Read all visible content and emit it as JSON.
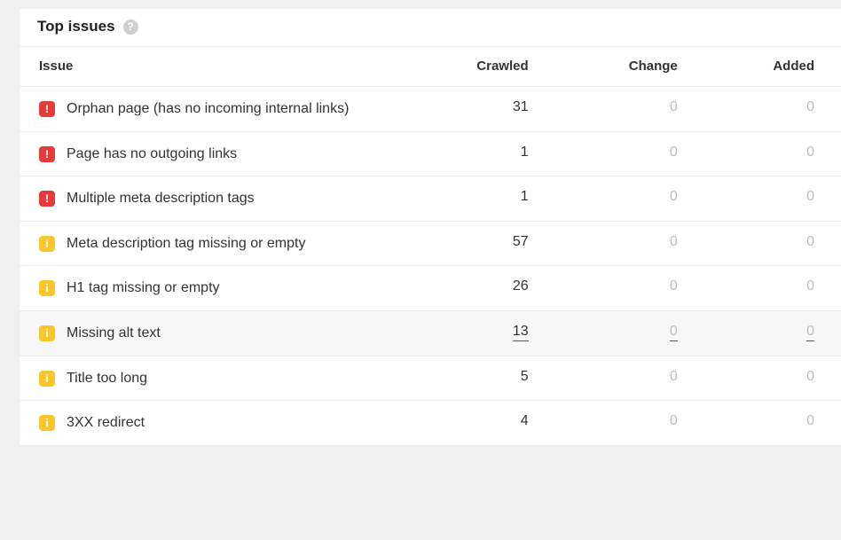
{
  "panel": {
    "title": "Top issues"
  },
  "columns": {
    "issue": "Issue",
    "crawled": "Crawled",
    "change": "Change",
    "added": "Added"
  },
  "severity_glyph": {
    "error": "!",
    "warning": "i"
  },
  "rows": [
    {
      "severity": "error",
      "issue": "Orphan page (has no incoming internal links)",
      "crawled": "31",
      "change": "0",
      "added": "0",
      "hover": false
    },
    {
      "severity": "error",
      "issue": "Page has no outgoing links",
      "crawled": "1",
      "change": "0",
      "added": "0",
      "hover": false
    },
    {
      "severity": "error",
      "issue": "Multiple meta description tags",
      "crawled": "1",
      "change": "0",
      "added": "0",
      "hover": false
    },
    {
      "severity": "warning",
      "issue": "Meta description tag missing or empty",
      "crawled": "57",
      "change": "0",
      "added": "0",
      "hover": false
    },
    {
      "severity": "warning",
      "issue": "H1 tag missing or empty",
      "crawled": "26",
      "change": "0",
      "added": "0",
      "hover": false
    },
    {
      "severity": "warning",
      "issue": "Missing alt text",
      "crawled": "13",
      "change": "0",
      "added": "0",
      "hover": true
    },
    {
      "severity": "warning",
      "issue": "Title too long",
      "crawled": "5",
      "change": "0",
      "added": "0",
      "hover": false
    },
    {
      "severity": "warning",
      "issue": "3XX redirect",
      "crawled": "4",
      "change": "0",
      "added": "0",
      "hover": false
    }
  ]
}
